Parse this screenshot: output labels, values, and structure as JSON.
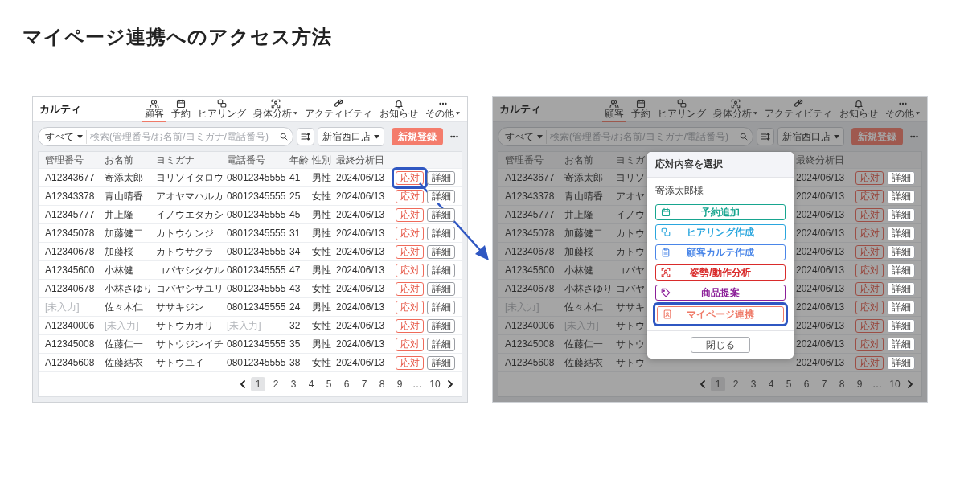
{
  "title": "マイページ連携へのアクセス方法",
  "screens": [
    {
      "app_title": "カルティ",
      "nav": [
        {
          "label": "顧客",
          "selected": true,
          "dropdown": false
        },
        {
          "label": "予約",
          "selected": false,
          "dropdown": false
        },
        {
          "label": "ヒアリング",
          "selected": false,
          "dropdown": false
        },
        {
          "label": "身体分析",
          "selected": false,
          "dropdown": true
        },
        {
          "label": "アクティビティ",
          "selected": false,
          "dropdown": false
        },
        {
          "label": "お知らせ",
          "selected": false,
          "dropdown": false
        },
        {
          "label": "その他",
          "selected": false,
          "dropdown": true
        }
      ],
      "scope": "すべて",
      "placeholder": "検索(管理番号/お名前/ヨミガナ/電話番号)",
      "store": "新宿西口店",
      "new_button": "新規登録",
      "columns": {
        "id": "管理番号",
        "name": "お名前",
        "kana": "ヨミガナ",
        "phone": "電話番号",
        "age": "年齢",
        "gender": "性別",
        "date": "最終分析日"
      },
      "rows": [
        {
          "id": "A12343677",
          "name": "寄添太郎",
          "kana": "ヨリソイタロウ",
          "phone": "08012345555",
          "age": "41",
          "gender": "男性",
          "date": "2024/06/13",
          "actions": [
            "応対",
            "詳細"
          ],
          "highlighted": true,
          "id_missing": false,
          "name_missing": false,
          "phone_missing": false
        },
        {
          "id": "A12343378",
          "name": "青山晴香",
          "kana": "アオヤマハルカ",
          "phone": "08012345555",
          "age": "25",
          "gender": "女性",
          "date": "2024/06/13",
          "actions": [
            "応対",
            "詳細"
          ],
          "highlighted": false,
          "id_missing": false,
          "name_missing": false,
          "phone_missing": false
        },
        {
          "id": "A12345777",
          "name": "井上隆",
          "kana": "イノウエタカシ",
          "phone": "08012345555",
          "age": "45",
          "gender": "男性",
          "date": "2024/06/13",
          "actions": [
            "応対",
            "詳細"
          ],
          "highlighted": false,
          "id_missing": false,
          "name_missing": false,
          "phone_missing": false
        },
        {
          "id": "A12345078",
          "name": "加藤健二",
          "kana": "カトウケンジ",
          "phone": "08012345555",
          "age": "31",
          "gender": "男性",
          "date": "2024/06/13",
          "actions": [
            "応対",
            "詳細"
          ],
          "highlighted": false,
          "id_missing": false,
          "name_missing": false,
          "phone_missing": false
        },
        {
          "id": "A12340678",
          "name": "加藤桜",
          "kana": "カトウサクラ",
          "phone": "08012345555",
          "age": "34",
          "gender": "女性",
          "date": "2024/06/13",
          "actions": [
            "応対",
            "詳細"
          ],
          "highlighted": false,
          "id_missing": false,
          "name_missing": false,
          "phone_missing": false
        },
        {
          "id": "A12345600",
          "name": "小林健",
          "kana": "コバヤシタケル",
          "phone": "08012345555",
          "age": "47",
          "gender": "男性",
          "date": "2024/06/13",
          "actions": [
            "応対",
            "詳細"
          ],
          "highlighted": false,
          "id_missing": false,
          "name_missing": false,
          "phone_missing": false
        },
        {
          "id": "A12340678",
          "name": "小林さゆり",
          "kana": "コバヤシサユリ",
          "phone": "08012345555",
          "age": "43",
          "gender": "女性",
          "date": "2024/06/13",
          "actions": [
            "応対",
            "詳細"
          ],
          "highlighted": false,
          "id_missing": false,
          "name_missing": false,
          "phone_missing": false
        },
        {
          "id": "[未入力]",
          "name": "佐々木仁",
          "kana": "ササキジン",
          "phone": "08012345555",
          "age": "24",
          "gender": "男性",
          "date": "2024/06/13",
          "actions": [
            "応対",
            "詳細"
          ],
          "highlighted": false,
          "id_missing": true,
          "name_missing": false,
          "phone_missing": false
        },
        {
          "id": "A12340006",
          "name": "[未入力]",
          "kana": "サトウカオリ",
          "phone": "[未入力]",
          "age": "32",
          "gender": "女性",
          "date": "2024/06/13",
          "actions": [
            "応対",
            "詳細"
          ],
          "highlighted": false,
          "id_missing": false,
          "name_missing": true,
          "phone_missing": true
        },
        {
          "id": "A12345008",
          "name": "佐藤仁一",
          "kana": "サトウジンイチ",
          "phone": "08012345555",
          "age": "35",
          "gender": "男性",
          "date": "2024/06/13",
          "actions": [
            "応対",
            "詳細"
          ],
          "highlighted": false,
          "id_missing": false,
          "name_missing": false,
          "phone_missing": false
        },
        {
          "id": "A12345608",
          "name": "佐藤結衣",
          "kana": "サトウユイ",
          "phone": "08012345555",
          "age": "38",
          "gender": "女性",
          "date": "2024/06/13",
          "actions": [
            "応対",
            "詳細"
          ],
          "highlighted": false,
          "id_missing": false,
          "name_missing": false,
          "phone_missing": false
        }
      ],
      "pages": [
        {
          "label": "1",
          "selected": true
        },
        {
          "label": "2",
          "selected": false
        },
        {
          "label": "3",
          "selected": false
        },
        {
          "label": "4",
          "selected": false
        },
        {
          "label": "5",
          "selected": false
        },
        {
          "label": "6",
          "selected": false
        },
        {
          "label": "7",
          "selected": false
        },
        {
          "label": "8",
          "selected": false
        },
        {
          "label": "9",
          "selected": false
        },
        {
          "label": "…",
          "selected": false
        },
        {
          "label": "10",
          "selected": false
        }
      ]
    },
    {
      "app_title": "カルティ",
      "nav": [
        {
          "label": "顧客",
          "selected": true,
          "dropdown": false
        },
        {
          "label": "予約",
          "selected": false,
          "dropdown": false
        },
        {
          "label": "ヒアリング",
          "selected": false,
          "dropdown": false
        },
        {
          "label": "身体分析",
          "selected": false,
          "dropdown": true
        },
        {
          "label": "アクティビティ",
          "selected": false,
          "dropdown": false
        },
        {
          "label": "お知らせ",
          "selected": false,
          "dropdown": false
        },
        {
          "label": "その他",
          "selected": false,
          "dropdown": true
        }
      ],
      "scope": "すべて",
      "placeholder": "検索(管理番号/お名前/ヨミガナ/電話番号)",
      "store": "新宿西口店",
      "new_button": "新規登録",
      "columns": {
        "id": "管理番号",
        "name": "お名前",
        "kana": "ヨミガ",
        "date": "最終分析日"
      },
      "rows": [
        {
          "id": "A12343677",
          "name": "寄添太郎",
          "kana": "ヨリソ",
          "date": "2024/06/13",
          "actions": [
            "応対",
            "詳細"
          ],
          "id_missing": false,
          "name_missing": false
        },
        {
          "id": "A12343378",
          "name": "青山晴香",
          "kana": "アオヤ",
          "date": "2024/06/13",
          "actions": [
            "応対",
            "詳細"
          ],
          "id_missing": false,
          "name_missing": false
        },
        {
          "id": "A12345777",
          "name": "井上隆",
          "kana": "イノウ",
          "date": "2024/06/13",
          "actions": [
            "応対",
            "詳細"
          ],
          "id_missing": false,
          "name_missing": false
        },
        {
          "id": "A12345078",
          "name": "加藤健二",
          "kana": "カトウ",
          "date": "2024/06/13",
          "actions": [
            "応対",
            "詳細"
          ],
          "id_missing": false,
          "name_missing": false
        },
        {
          "id": "A12340678",
          "name": "加藤桜",
          "kana": "カトウ",
          "date": "2024/06/13",
          "actions": [
            "応対",
            "詳細"
          ],
          "id_missing": false,
          "name_missing": false
        },
        {
          "id": "A12345600",
          "name": "小林健",
          "kana": "コバヤ",
          "date": "2024/06/13",
          "actions": [
            "応対",
            "詳細"
          ],
          "id_missing": false,
          "name_missing": false
        },
        {
          "id": "A12340678",
          "name": "小林さゆり",
          "kana": "コバヤ",
          "date": "2024/06/13",
          "actions": [
            "応対",
            "詳細"
          ],
          "id_missing": false,
          "name_missing": false
        },
        {
          "id": "[未入力]",
          "name": "佐々木仁",
          "kana": "ササキ",
          "date": "2024/06/13",
          "actions": [
            "応対",
            "詳細"
          ],
          "id_missing": true,
          "name_missing": false
        },
        {
          "id": "A12340006",
          "name": "[未入力]",
          "kana": "サトウ",
          "date": "2024/06/13",
          "actions": [
            "応対",
            "詳細"
          ],
          "id_missing": false,
          "name_missing": true
        },
        {
          "id": "A12345008",
          "name": "佐藤仁一",
          "kana": "サトウ",
          "date": "2024/06/13",
          "actions": [
            "応対",
            "詳細"
          ],
          "id_missing": false,
          "name_missing": false
        },
        {
          "id": "A12345608",
          "name": "佐藤結衣",
          "kana": "サトウ",
          "date": "2024/06/13",
          "actions": [
            "応対",
            "詳細"
          ],
          "id_missing": false,
          "name_missing": false
        }
      ],
      "pages": [
        {
          "label": "1",
          "selected": true
        },
        {
          "label": "2",
          "selected": false
        },
        {
          "label": "3",
          "selected": false
        },
        {
          "label": "4",
          "selected": false
        },
        {
          "label": "5",
          "selected": false
        },
        {
          "label": "6",
          "selected": false
        },
        {
          "label": "7",
          "selected": false
        },
        {
          "label": "8",
          "selected": false
        },
        {
          "label": "9",
          "selected": false
        },
        {
          "label": "…",
          "selected": false
        },
        {
          "label": "10",
          "selected": false
        }
      ],
      "modal": {
        "title": "応対内容を選択",
        "customer": "寄添太郎様",
        "options": [
          {
            "label": "予約追加",
            "color": "#17a58f",
            "highlighted": false
          },
          {
            "label": "ヒアリング作成",
            "color": "#2aa6de",
            "highlighted": false
          },
          {
            "label": "顧客カルテ作成",
            "color": "#4a86e8",
            "highlighted": false
          },
          {
            "label": "姿勢/動作分析",
            "color": "#d92b2b",
            "highlighted": false
          },
          {
            "label": "商品提案",
            "color": "#8b1e98",
            "highlighted": false
          },
          {
            "label": "マイページ連携",
            "color": "#ef7a68",
            "highlighted": true
          }
        ],
        "close": "閉じる"
      }
    }
  ]
}
